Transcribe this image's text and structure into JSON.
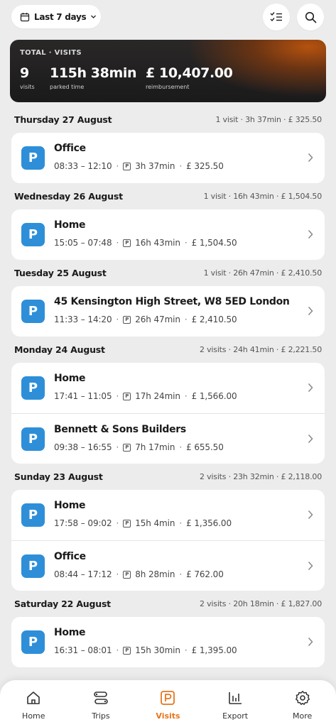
{
  "filter": {
    "label": "Last 7 days"
  },
  "summary": {
    "label": "TOTAL · VISITS",
    "visits": {
      "value": "9",
      "caption": "visits"
    },
    "parked": {
      "value": "115h 38min",
      "caption": "parked time"
    },
    "reimbursement": {
      "value": "£ 10,407.00",
      "caption": "reimbursement"
    }
  },
  "days": [
    {
      "title": "Thursday 27 August",
      "summary": "1 visit · 3h 37min · £ 325.50",
      "visits": [
        {
          "name": "Office",
          "time": "08:33 – 12:10",
          "duration": "3h 37min",
          "amount": "£ 325.50"
        }
      ]
    },
    {
      "title": "Wednesday 26 August",
      "summary": "1 visit · 16h 43min · £ 1,504.50",
      "visits": [
        {
          "name": "Home",
          "time": "15:05 – 07:48",
          "duration": "16h 43min",
          "amount": "£ 1,504.50"
        }
      ]
    },
    {
      "title": "Tuesday 25 August",
      "summary": "1 visit · 26h 47min · £ 2,410.50",
      "visits": [
        {
          "name": "45 Kensington High Street, W8 5ED London",
          "time": "11:33 – 14:20",
          "duration": "26h 47min",
          "amount": "£ 2,410.50"
        }
      ]
    },
    {
      "title": "Monday 24 August",
      "summary": "2 visits · 24h 41min · £ 2,221.50",
      "visits": [
        {
          "name": "Home",
          "time": "17:41 – 11:05",
          "duration": "17h 24min",
          "amount": "£ 1,566.00"
        },
        {
          "name": "Bennett & Sons Builders",
          "time": "09:38 – 16:55",
          "duration": "7h 17min",
          "amount": "£ 655.50"
        }
      ]
    },
    {
      "title": "Sunday 23 August",
      "summary": "2 visits · 23h 32min · £ 2,118.00",
      "visits": [
        {
          "name": "Home",
          "time": "17:58 – 09:02",
          "duration": "15h 4min",
          "amount": "£ 1,356.00"
        },
        {
          "name": "Office",
          "time": "08:44 – 17:12",
          "duration": "8h 28min",
          "amount": "£ 762.00"
        }
      ]
    },
    {
      "title": "Saturday 22 August",
      "summary": "2 visits · 20h 18min · £ 1,827.00",
      "visits": [
        {
          "name": "Home",
          "time": "16:31 – 08:01",
          "duration": "15h 30min",
          "amount": "£ 1,395.00"
        }
      ]
    }
  ],
  "badge": "P",
  "parking_mark": "P",
  "tabs": [
    {
      "label": "Home",
      "icon": "home-icon"
    },
    {
      "label": "Trips",
      "icon": "trips-icon"
    },
    {
      "label": "Visits",
      "icon": "parking-icon",
      "active": true
    },
    {
      "label": "Export",
      "icon": "chart-icon"
    },
    {
      "label": "More",
      "icon": "gear-icon"
    }
  ],
  "colors": {
    "accent": "#e5761f",
    "badge": "#2e8fd8",
    "background": "#ececec"
  }
}
